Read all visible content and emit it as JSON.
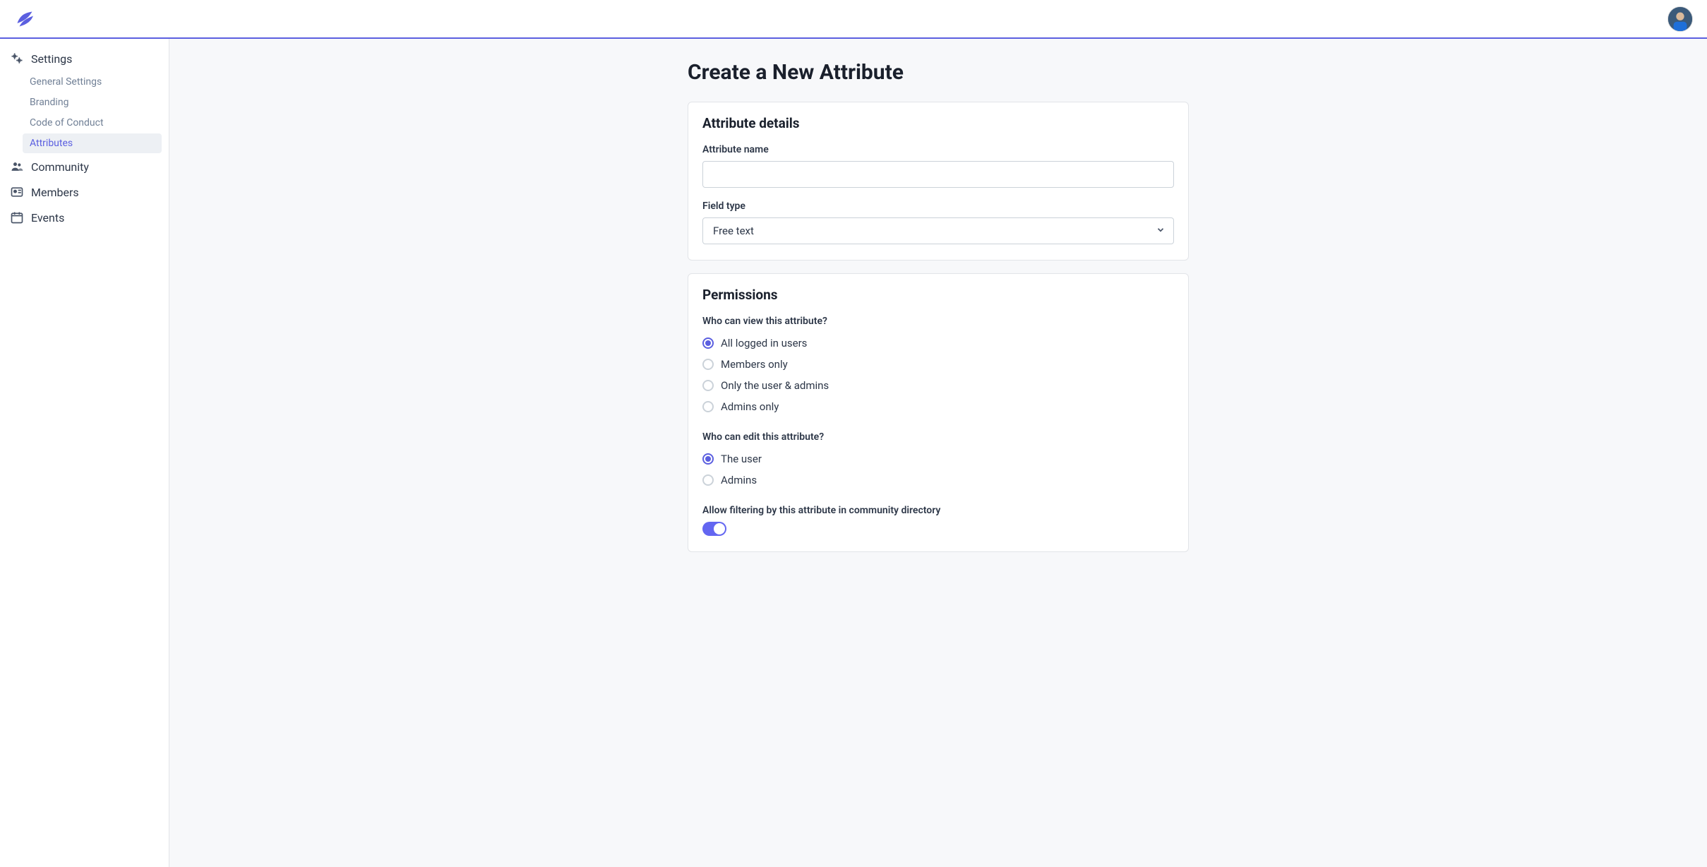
{
  "sidebar": {
    "sections": [
      {
        "label": "Settings",
        "items": [
          "General Settings",
          "Branding",
          "Code of Conduct",
          "Attributes"
        ],
        "activeItem": "Attributes"
      },
      {
        "label": "Community"
      },
      {
        "label": "Members"
      },
      {
        "label": "Events"
      }
    ]
  },
  "page": {
    "title": "Create a New Attribute"
  },
  "details": {
    "card_title": "Attribute details",
    "name_label": "Attribute name",
    "name_value": "",
    "type_label": "Field type",
    "type_value": "Free text"
  },
  "permissions": {
    "card_title": "Permissions",
    "view_label": "Who can view this attribute?",
    "view_options": [
      "All logged in users",
      "Members only",
      "Only the user & admins",
      "Admins only"
    ],
    "view_selected": "All logged in users",
    "edit_label": "Who can edit this attribute?",
    "edit_options": [
      "The user",
      "Admins"
    ],
    "edit_selected": "The user",
    "filter_label": "Allow filtering by this attribute in community directory",
    "filter_enabled": true
  }
}
